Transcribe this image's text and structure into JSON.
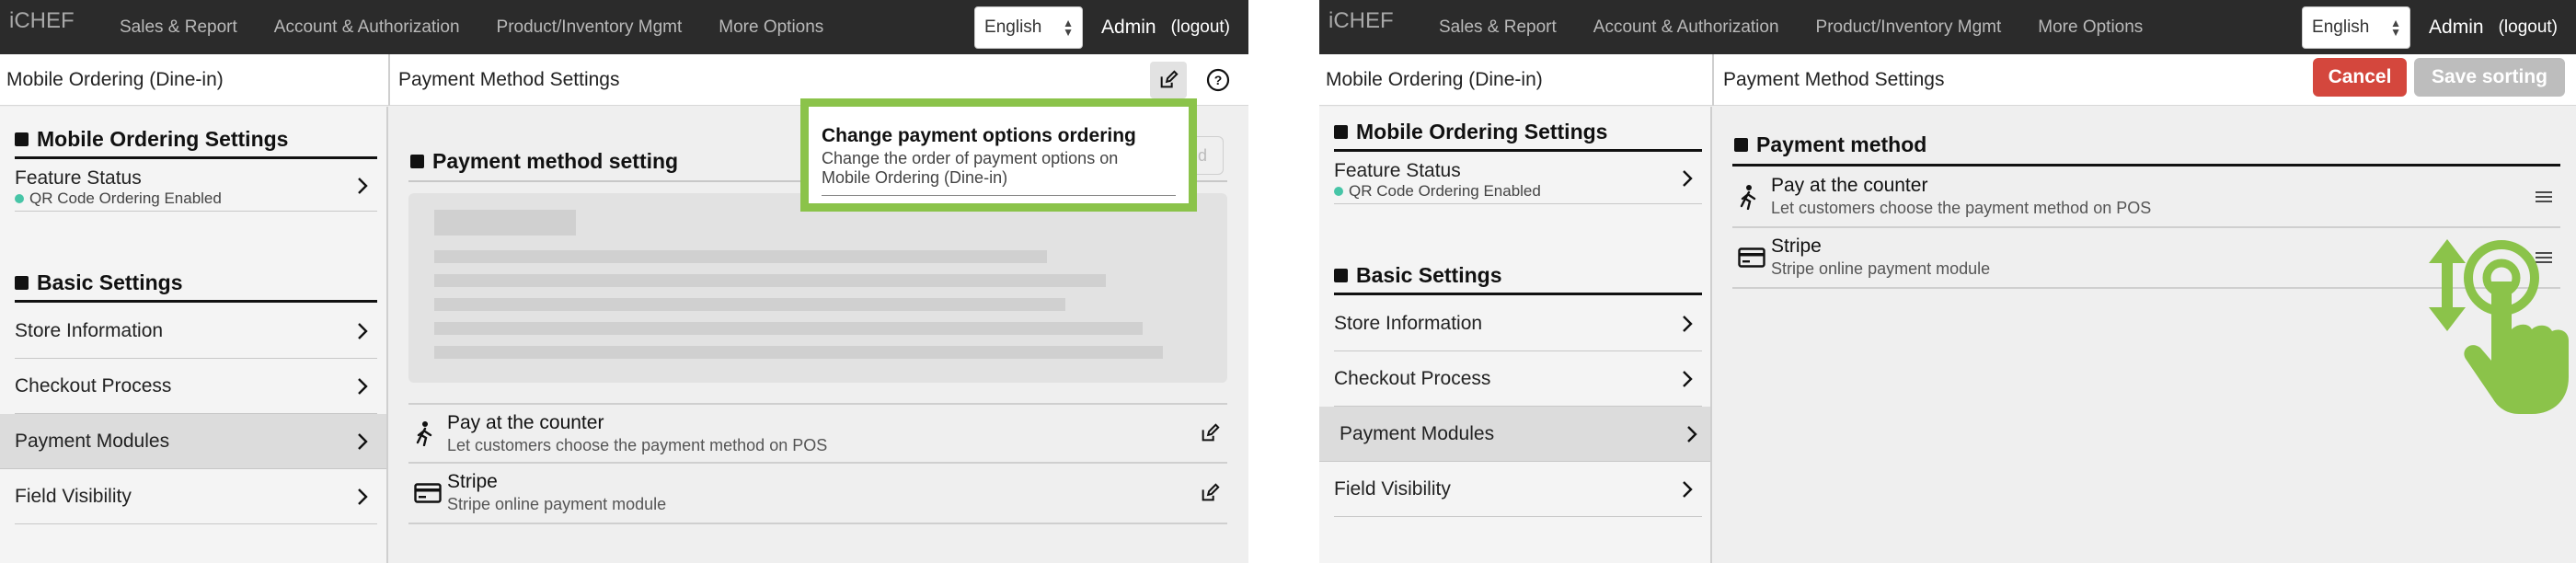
{
  "nav": {
    "logo": "iCHEF",
    "links": [
      "Sales & Report",
      "Account & Authorization",
      "Product/Inventory Mgmt",
      "More Options"
    ],
    "language": "English",
    "admin": "Admin",
    "logout": "(logout)"
  },
  "left": {
    "breadcrumb": "Mobile Ordering (Dine-in)",
    "title": "Payment Method Settings",
    "sidebar": {
      "section1": "Mobile Ordering Settings",
      "feature_label": "Feature Status",
      "feature_status": "QR Code Ordering Enabled",
      "section2": "Basic Settings",
      "items": [
        "Store Information",
        "Checkout Process",
        "Payment Modules",
        "Field Visibility"
      ]
    },
    "content": {
      "section_title": "Payment method setting",
      "ghost_button": "d",
      "methods": [
        {
          "name": "Pay at the counter",
          "desc": "Let customers choose the payment method on POS",
          "icon": "person-walking-icon"
        },
        {
          "name": "Stripe",
          "desc": "Stripe online payment module",
          "icon": "credit-card-icon"
        }
      ]
    },
    "tooltip": {
      "title": "Change payment options ordering",
      "body": "Change the order of payment options on Mobile Ordering (Dine-in)"
    }
  },
  "right": {
    "breadcrumb": "Mobile Ordering (Dine-in)",
    "title": "Payment Method Settings",
    "cancel": "Cancel",
    "save_sorting": "Save sorting",
    "sidebar": {
      "section1": "Mobile Ordering Settings",
      "feature_label": "Feature Status",
      "feature_status": "QR Code Ordering Enabled",
      "section2": "Basic Settings",
      "items": [
        "Store Information",
        "Checkout Process",
        "Payment Modules",
        "Field Visibility"
      ]
    },
    "content": {
      "section_title": "Payment method",
      "methods": [
        {
          "name": "Pay at the counter",
          "desc": "Let customers choose the payment method on POS",
          "icon": "person-walking-icon"
        },
        {
          "name": "Stripe",
          "desc": "Stripe online payment module",
          "icon": "credit-card-icon"
        }
      ]
    }
  },
  "colors": {
    "accent_green": "#8bc34a",
    "cancel_red": "#d4473d",
    "status_dot": "#47c5a7",
    "nav_bg": "#2b2b2b"
  }
}
